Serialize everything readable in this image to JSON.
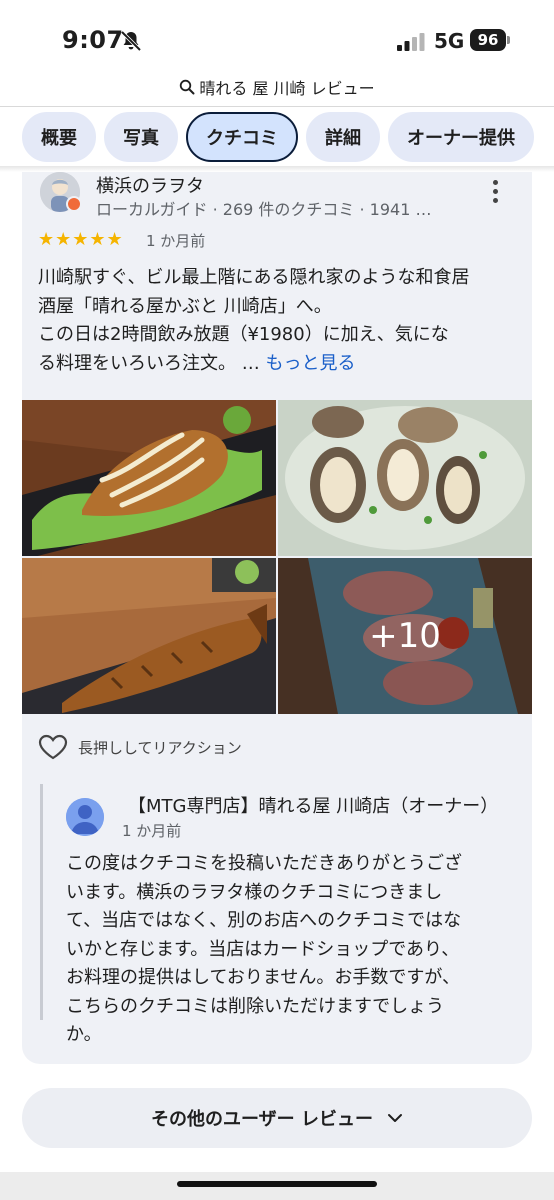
{
  "status_bar": {
    "time": "9:07",
    "network": "5G",
    "battery": "96",
    "icons": [
      "bell-slash-icon",
      "signal-bars-icon"
    ]
  },
  "search": {
    "query": "晴れる 屋 川崎 レビュー",
    "icon": "search-icon"
  },
  "tabs": [
    {
      "label": "概要",
      "active": false
    },
    {
      "label": "写真",
      "active": false
    },
    {
      "label": "クチコミ",
      "active": true
    },
    {
      "label": "詳細",
      "active": false
    },
    {
      "label": "オーナー提供",
      "active": false
    }
  ],
  "review": {
    "reviewer_name": "横浜のラヲタ",
    "reviewer_meta": "ローカルガイド · 269 件のクチコミ · 1941 …",
    "rating": 5,
    "stars_text": "★★★★★",
    "date": "1 か月前",
    "text_lines": [
      "川崎駅すぐ、ビル最上階にある隠れ家のような和食居",
      "酒屋「晴れる屋かぶと 川崎店」へ。",
      "この日は2時間飲み放題（¥1980）に加え、気にな",
      "る料理をいろいろ注文。 … "
    ],
    "read_more": "もっと見る",
    "photo_more_count": "+10",
    "reaction_label": "長押ししてリアクション"
  },
  "owner_reply": {
    "name": "【MTG専門店】晴れる屋 川崎店（オーナー）",
    "date": "1 か月前",
    "text_lines": [
      "この度はクチコミを投稿いただきありがとうござ",
      "います。横浜のラヲタ様のクチコミにつきまし",
      "て、当店ではなく、別のお店へのクチコミではな",
      "いかと存じます。当店はカードショップであり、",
      "お料理の提供はしておりません。お手数ですが、",
      "こちらのクチコミは削除いただけますでしょう",
      "か。"
    ]
  },
  "footer": {
    "other_reviews": "その他のユーザー レビュー"
  },
  "colors": {
    "accent": "#1a5fc9",
    "star": "#f5b400",
    "tab_bg": "#e4e9f7",
    "card_bg": "#eff1f6"
  }
}
